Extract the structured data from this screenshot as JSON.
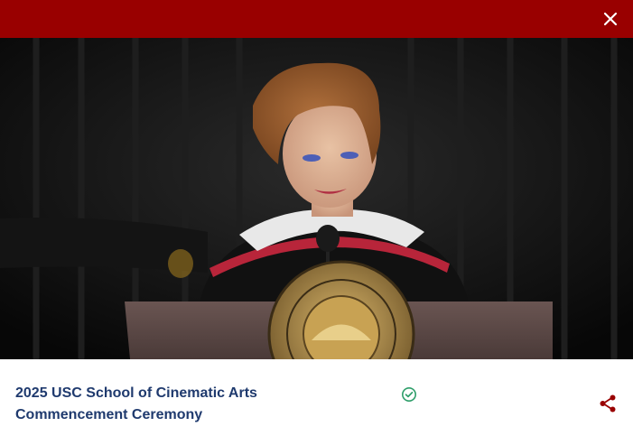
{
  "modal": {
    "close_icon": "close-icon",
    "topbar_color": "#990000"
  },
  "video": {
    "still": "commencement-speaker-at-podium"
  },
  "info": {
    "title_line1": "2025 USC School of Cinematic Arts",
    "title_line2": "Commencement Ceremony",
    "title_color": "#1f3a6e",
    "verified_icon": "check-circle-icon",
    "verified_color": "#2e9e6a",
    "share_icon": "share-icon",
    "share_color": "#990000"
  }
}
